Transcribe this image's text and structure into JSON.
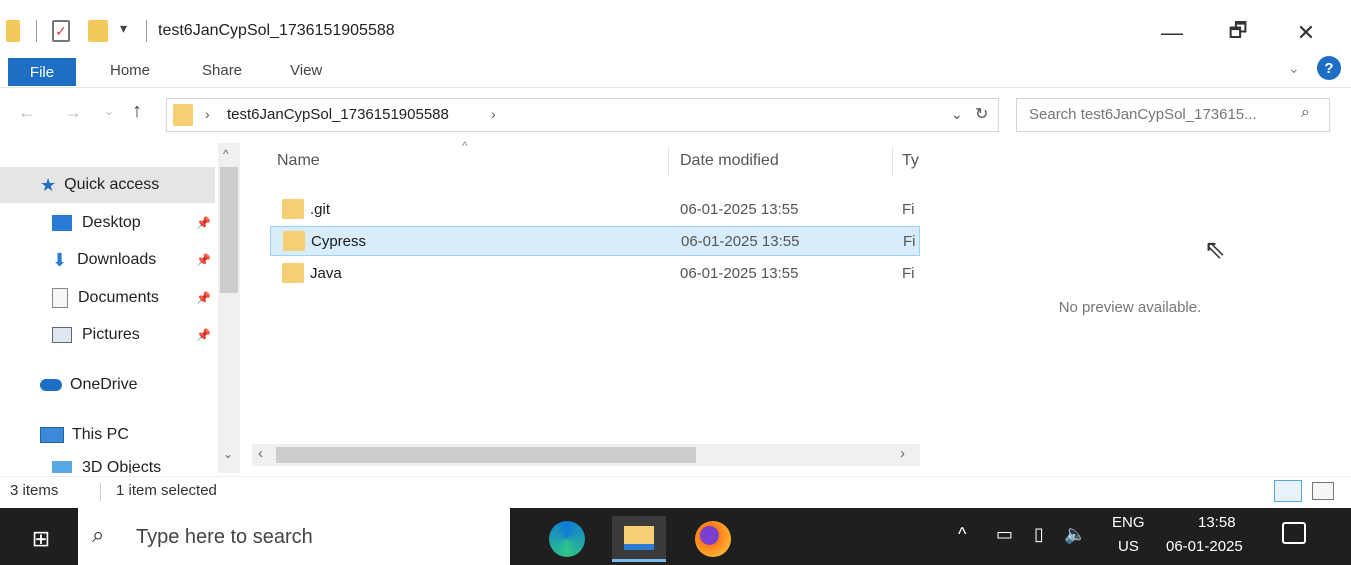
{
  "window": {
    "title": "test6JanCypSol_1736151905588",
    "controls": {
      "minimize": "—",
      "maximize": "🗗",
      "close": "✕"
    }
  },
  "ribbon": {
    "tabs": [
      "File",
      "Home",
      "Share",
      "View"
    ]
  },
  "address": {
    "breadcrumb": "test6JanCypSol_1736151905588",
    "search_placeholder": "Search test6JanCypSol_173615..."
  },
  "nav": {
    "items": [
      {
        "label": "Quick access",
        "icon": "star-icon",
        "selected": true
      },
      {
        "label": "Desktop",
        "icon": "desktop-icon",
        "pinned": true
      },
      {
        "label": "Downloads",
        "icon": "download-icon",
        "pinned": true
      },
      {
        "label": "Documents",
        "icon": "document-icon",
        "pinned": true
      },
      {
        "label": "Pictures",
        "icon": "pictures-icon",
        "pinned": true
      },
      {
        "label": "OneDrive",
        "icon": "cloud-icon"
      },
      {
        "label": "This PC",
        "icon": "computer-icon"
      },
      {
        "label": "3D Objects",
        "icon": "cube-icon"
      }
    ]
  },
  "files": {
    "columns": [
      "Name",
      "Date modified",
      "Ty"
    ],
    "rows": [
      {
        "name": ".git",
        "date": "06-01-2025 13:55",
        "type": "Fi",
        "selected": false
      },
      {
        "name": "Cypress",
        "date": "06-01-2025 13:55",
        "type": "Fi",
        "selected": true
      },
      {
        "name": "Java",
        "date": "06-01-2025 13:55",
        "type": "Fi",
        "selected": false
      }
    ]
  },
  "preview": {
    "text": "No preview available."
  },
  "status": {
    "count": "3 items",
    "selection": "1 item selected"
  },
  "taskbar": {
    "search_placeholder": "Type here to search",
    "lang_top": "ENG",
    "lang_bottom": "US",
    "time": "13:58",
    "date": "06-01-2025"
  },
  "colors": {
    "accent": "#1e6fc4",
    "selection": "#d9ecfb",
    "folder": "#f4cf73",
    "taskbar": "#1f1f1f"
  }
}
